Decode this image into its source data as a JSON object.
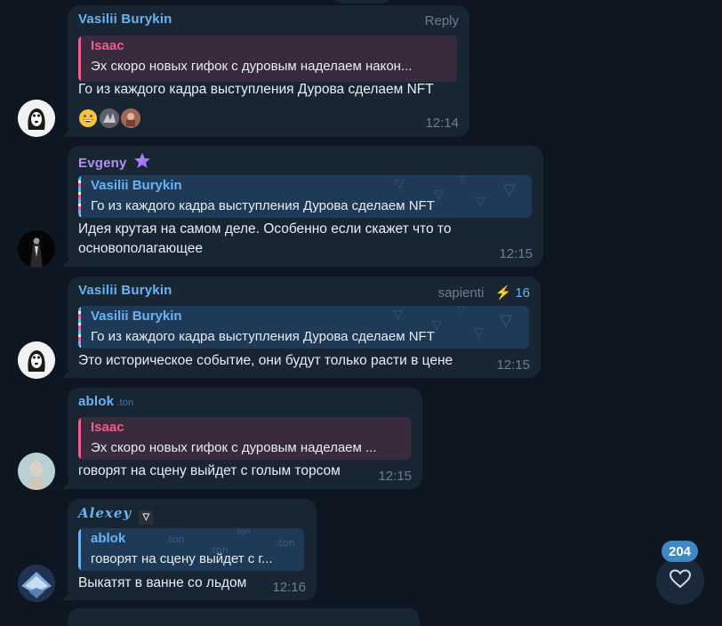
{
  "colors": {
    "background": "#0e1621",
    "bubble": "#182533",
    "blue_name": "#6ab2f2",
    "purple_name": "#b38ff0",
    "pink_name": "#ee5d8c",
    "time": "#6d7f8f",
    "badge": "#3e88c8"
  },
  "messages": [
    {
      "author": "Vasilii Burykin",
      "meta": "Reply",
      "reply_author": "Isaac",
      "reply_text": "Эх скоро новых гифок с дуровым наделаем након...",
      "text": "Го из каждого кадра выступления Дурова сделаем NFT",
      "time": "12:14",
      "reactions": [
        "grinning-face-emoji",
        "sticker-reaction",
        "sticker-reaction"
      ]
    },
    {
      "author": "Evgeny",
      "author_badge_icon": "premium-star-icon",
      "reply_author": "Vasilii Burykin",
      "reply_text": "Го из каждого кадра выступления Дурова сделаем NFT",
      "text_line1": "Идея крутая на самом деле. Особенно если скажет что то",
      "text_line2": "основополагающее",
      "time": "12:15"
    },
    {
      "author": "Vasilii Burykin",
      "meta": "sapienti",
      "boost_count": "16",
      "reply_author": "Vasilii Burykin",
      "reply_text": "Го из каждого кадра выступления Дурова сделаем NFT",
      "text": "Это историческое событие, они будут только расти в цене",
      "time": "12:15"
    },
    {
      "author": "ablok",
      "author_suffix": ".ton",
      "reply_author": "Isaac",
      "reply_text": "Эх скоро новых гифок с дуровым наделаем ...",
      "text": "говорят на сцену выйдет с голым торсом",
      "time": "12:15"
    },
    {
      "author": "Alexey",
      "reply_author": "ablok",
      "reply_text": "говорят на сцену выйдет с г...",
      "reply_pattern": ".ton",
      "text": "Выкатят в ванне со льдом",
      "time": "12:16"
    }
  ],
  "reaction_button": {
    "count": "204",
    "icon": "heart-icon"
  }
}
